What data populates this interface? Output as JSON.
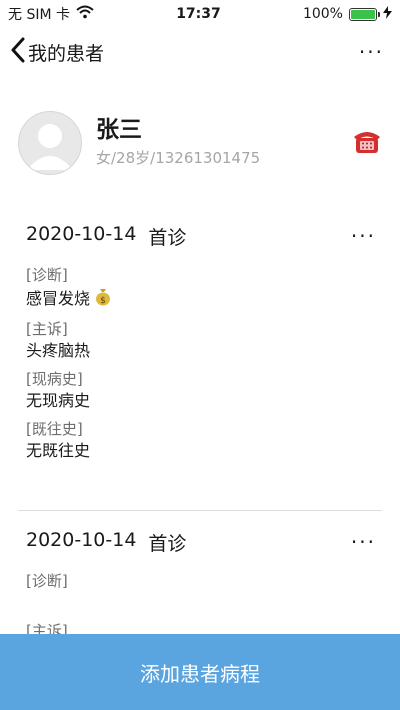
{
  "status_bar": {
    "carrier": "无 SIM 卡",
    "time": "17:37",
    "battery_text": "100%",
    "battery_level": 1.0,
    "battery_color": "#3ac24a"
  },
  "nav": {
    "title": "我的患者",
    "more_label": "···"
  },
  "patient": {
    "name": "张三",
    "info": "女/28岁/13261301475"
  },
  "records": [
    {
      "date": "2020-10-14",
      "visit_type": "首诊",
      "more_label": "···",
      "fields": [
        {
          "label": "[诊断]",
          "value": "感冒发烧"
        },
        {
          "label": "[主诉]",
          "value": "头疼脑热"
        },
        {
          "label": "[现病史]",
          "value": "无现病史"
        },
        {
          "label": "[既往史]",
          "value": "无既往史"
        }
      ]
    },
    {
      "date": "2020-10-14",
      "visit_type": "首诊",
      "more_label": "···",
      "fields": [
        {
          "label": "[诊断]",
          "value": ""
        },
        {
          "label": "[主诉]",
          "value": ""
        }
      ]
    }
  ],
  "footer": {
    "add_label": "添加患者病程",
    "color": "#5aa4e0"
  },
  "icons": {
    "back": "chevron-left-icon",
    "phone": "telephone-icon",
    "wifi": "wifi-icon",
    "battery": "battery-icon",
    "charging": "charging-bolt-icon",
    "money_bag": "money-bag-icon"
  }
}
